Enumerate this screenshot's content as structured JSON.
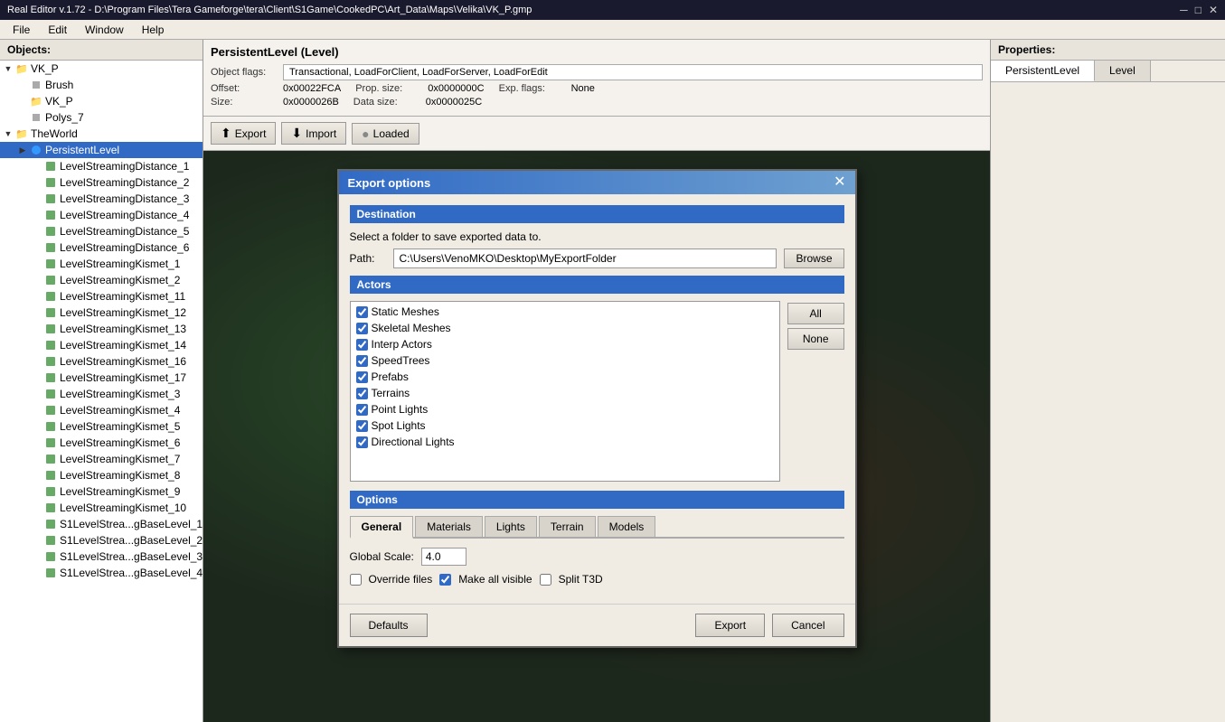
{
  "titlebar": {
    "text": "Real Editor v.1.72 - D:\\Program Files\\Tera Gameforge\\tera\\Client\\S1Game\\CookedPC\\Art_Data\\Maps\\Velika\\VK_P.gmp",
    "minimize": "─",
    "maximize": "□",
    "close": "✕"
  },
  "menubar": {
    "items": [
      "File",
      "Edit",
      "Window",
      "Help"
    ]
  },
  "left_panel": {
    "header": "Objects:",
    "tree": [
      {
        "id": "vk_p_root",
        "label": "VK_P",
        "type": "folder",
        "level": 0,
        "expanded": true,
        "arrow": "▼"
      },
      {
        "id": "brush",
        "label": "Brush",
        "type": "poly",
        "level": 1,
        "expanded": false,
        "arrow": ""
      },
      {
        "id": "vk_p_sub",
        "label": "VK_P",
        "type": "folder",
        "level": 1,
        "expanded": false,
        "arrow": ""
      },
      {
        "id": "polys_7",
        "label": "Polys_7",
        "type": "poly",
        "level": 1,
        "expanded": false,
        "arrow": ""
      },
      {
        "id": "theworld",
        "label": "TheWorld",
        "type": "folder",
        "level": 0,
        "expanded": true,
        "arrow": "▼"
      },
      {
        "id": "persistent_level",
        "label": "PersistentLevel",
        "type": "level",
        "level": 1,
        "expanded": true,
        "arrow": "▶",
        "selected": true
      },
      {
        "id": "lsd1",
        "label": "LevelStreamingDistance_1",
        "type": "mesh",
        "level": 2,
        "expanded": false,
        "arrow": ""
      },
      {
        "id": "lsd2",
        "label": "LevelStreamingDistance_2",
        "type": "mesh",
        "level": 2,
        "expanded": false,
        "arrow": ""
      },
      {
        "id": "lsd3",
        "label": "LevelStreamingDistance_3",
        "type": "mesh",
        "level": 2,
        "expanded": false,
        "arrow": ""
      },
      {
        "id": "lsd4",
        "label": "LevelStreamingDistance_4",
        "type": "mesh",
        "level": 2,
        "expanded": false,
        "arrow": ""
      },
      {
        "id": "lsd5",
        "label": "LevelStreamingDistance_5",
        "type": "mesh",
        "level": 2,
        "expanded": false,
        "arrow": ""
      },
      {
        "id": "lsd6",
        "label": "LevelStreamingDistance_6",
        "type": "mesh",
        "level": 2,
        "expanded": false,
        "arrow": ""
      },
      {
        "id": "lsk1",
        "label": "LevelStreamingKismet_1",
        "type": "mesh",
        "level": 2,
        "expanded": false,
        "arrow": ""
      },
      {
        "id": "lsk2",
        "label": "LevelStreamingKismet_2",
        "type": "mesh",
        "level": 2,
        "expanded": false,
        "arrow": ""
      },
      {
        "id": "lsk11",
        "label": "LevelStreamingKismet_11",
        "type": "mesh",
        "level": 2,
        "expanded": false,
        "arrow": ""
      },
      {
        "id": "lsk12",
        "label": "LevelStreamingKismet_12",
        "type": "mesh",
        "level": 2,
        "expanded": false,
        "arrow": ""
      },
      {
        "id": "lsk13",
        "label": "LevelStreamingKismet_13",
        "type": "mesh",
        "level": 2,
        "expanded": false,
        "arrow": ""
      },
      {
        "id": "lsk14",
        "label": "LevelStreamingKismet_14",
        "type": "mesh",
        "level": 2,
        "expanded": false,
        "arrow": ""
      },
      {
        "id": "lsk16",
        "label": "LevelStreamingKismet_16",
        "type": "mesh",
        "level": 2,
        "expanded": false,
        "arrow": ""
      },
      {
        "id": "lsk17",
        "label": "LevelStreamingKismet_17",
        "type": "mesh",
        "level": 2,
        "expanded": false,
        "arrow": ""
      },
      {
        "id": "lsk3",
        "label": "LevelStreamingKismet_3",
        "type": "mesh",
        "level": 2,
        "expanded": false,
        "arrow": ""
      },
      {
        "id": "lsk4",
        "label": "LevelStreamingKismet_4",
        "type": "mesh",
        "level": 2,
        "expanded": false,
        "arrow": ""
      },
      {
        "id": "lsk5",
        "label": "LevelStreamingKismet_5",
        "type": "mesh",
        "level": 2,
        "expanded": false,
        "arrow": ""
      },
      {
        "id": "lsk6",
        "label": "LevelStreamingKismet_6",
        "type": "mesh",
        "level": 2,
        "expanded": false,
        "arrow": ""
      },
      {
        "id": "lsk7",
        "label": "LevelStreamingKismet_7",
        "type": "mesh",
        "level": 2,
        "expanded": false,
        "arrow": ""
      },
      {
        "id": "lsk8",
        "label": "LevelStreamingKismet_8",
        "type": "mesh",
        "level": 2,
        "expanded": false,
        "arrow": ""
      },
      {
        "id": "lsk9",
        "label": "LevelStreamingKismet_9",
        "type": "mesh",
        "level": 2,
        "expanded": false,
        "arrow": ""
      },
      {
        "id": "lsk10",
        "label": "LevelStreamingKismet_10",
        "type": "mesh",
        "level": 2,
        "expanded": false,
        "arrow": ""
      },
      {
        "id": "s1base1",
        "label": "S1LevelStrea...gBaseLevel_1",
        "type": "mesh",
        "level": 2,
        "expanded": false,
        "arrow": ""
      },
      {
        "id": "s1base2",
        "label": "S1LevelStrea...gBaseLevel_2",
        "type": "mesh",
        "level": 2,
        "expanded": false,
        "arrow": ""
      },
      {
        "id": "s1base3",
        "label": "S1LevelStrea...gBaseLevel_3",
        "type": "mesh",
        "level": 2,
        "expanded": false,
        "arrow": ""
      },
      {
        "id": "s1base4",
        "label": "S1LevelStrea...gBaseLevel_4",
        "type": "mesh",
        "level": 2,
        "expanded": false,
        "arrow": ""
      }
    ]
  },
  "object_info": {
    "title": "PersistentLevel (Level)",
    "flags_label": "Object flags:",
    "flags_value": "Transactional, LoadForClient, LoadForServer, LoadForEdit",
    "offset_label": "Offset:",
    "offset_value": "0x00022FCA",
    "prop_size_label": "Prop. size:",
    "prop_size_value": "0x0000000C",
    "exp_flags_label": "Exp. flags:",
    "exp_flags_value": "None",
    "size_label": "Size:",
    "size_value": "0x0000026B",
    "data_size_label": "Data size:",
    "data_size_value": "0x0000025C"
  },
  "action_bar": {
    "export_label": "Export",
    "import_label": "Import",
    "loaded_label": "Loaded",
    "export_icon": "⬆",
    "import_icon": "⬇",
    "loaded_icon": "●"
  },
  "export_dialog": {
    "title": "Export options",
    "close_icon": "✕",
    "destination_header": "Destination",
    "destination_hint": "Select a folder to save exported data to.",
    "path_label": "Path:",
    "path_value": "C:\\Users\\VenoMKO\\Desktop\\MyExportFolder",
    "browse_label": "Browse",
    "actors_header": "Actors",
    "actors": [
      {
        "id": "static_meshes",
        "label": "Static Meshes",
        "checked": true
      },
      {
        "id": "skeletal_meshes",
        "label": "Skeletal Meshes",
        "checked": true
      },
      {
        "id": "interp_actors",
        "label": "Interp Actors",
        "checked": true
      },
      {
        "id": "speed_trees",
        "label": "SpeedTrees",
        "checked": true
      },
      {
        "id": "prefabs",
        "label": "Prefabs",
        "checked": true
      },
      {
        "id": "terrains",
        "label": "Terrains",
        "checked": true
      },
      {
        "id": "point_lights",
        "label": "Point Lights",
        "checked": true
      },
      {
        "id": "spot_lights",
        "label": "Spot Lights",
        "checked": true
      },
      {
        "id": "directional_lights",
        "label": "Directional Lights",
        "checked": true
      }
    ],
    "all_btn": "All",
    "none_btn": "None",
    "options_header": "Options",
    "tabs": [
      {
        "id": "general",
        "label": "General",
        "active": true
      },
      {
        "id": "materials",
        "label": "Materials",
        "active": false
      },
      {
        "id": "lights",
        "label": "Lights",
        "active": false
      },
      {
        "id": "terrain",
        "label": "Terrain",
        "active": false
      },
      {
        "id": "models",
        "label": "Models",
        "active": false
      }
    ],
    "global_scale_label": "Global Scale:",
    "global_scale_value": "4.0",
    "override_files_label": "Override files",
    "override_files_checked": false,
    "make_all_visible_label": "Make all visible",
    "make_all_visible_checked": true,
    "split_t3d_label": "Split T3D",
    "split_t3d_checked": false,
    "defaults_btn": "Defaults",
    "export_btn": "Export",
    "cancel_btn": "Cancel"
  },
  "properties_panel": {
    "header": "Properties:",
    "tabs": [
      {
        "id": "persistent_level",
        "label": "PersistentLevel"
      },
      {
        "id": "level",
        "label": "Level"
      }
    ]
  }
}
